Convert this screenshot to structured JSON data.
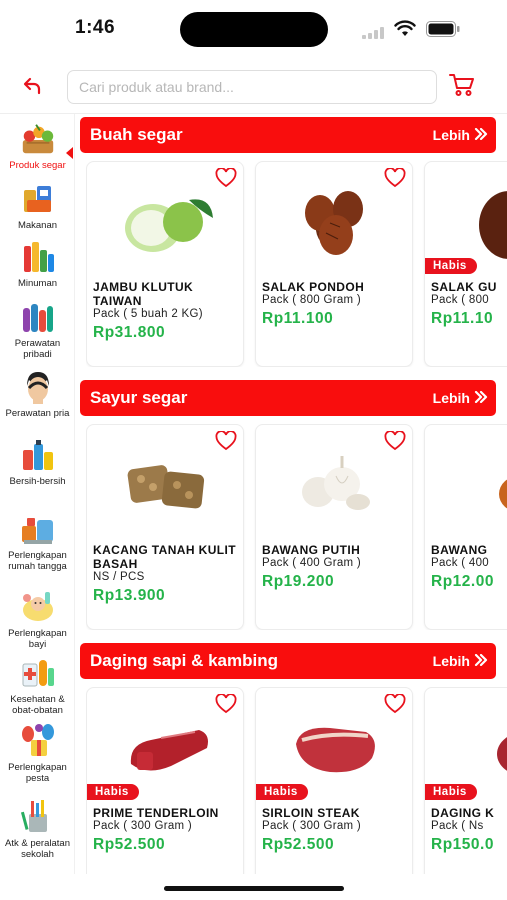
{
  "status": {
    "time": "1:46"
  },
  "search": {
    "placeholder": "Cari produk atau brand..."
  },
  "colors": {
    "accent": "#f90d0d",
    "price": "#25b34a",
    "sold_out": "#e8121d"
  },
  "icons": {
    "back": "back-arrow-icon",
    "cart": "cart-icon",
    "favorite": "heart-outline-icon",
    "more": "double-chevron-right-icon"
  },
  "sidebar": {
    "items": [
      {
        "label": "Produk segar",
        "icon": "fresh-produce-icon",
        "active": true
      },
      {
        "label": "Makanan",
        "icon": "food-icon"
      },
      {
        "label": "Minuman",
        "icon": "drinks-icon"
      },
      {
        "label": "Perawatan pribadi",
        "icon": "personal-care-icon"
      },
      {
        "label": "Perawatan pria",
        "icon": "mens-care-icon"
      },
      {
        "label": "Bersih-bersih",
        "icon": "cleaning-icon"
      },
      {
        "label": "Perlengkapan rumah tangga",
        "icon": "household-icon"
      },
      {
        "label": "Perlengkapan bayi",
        "icon": "baby-icon"
      },
      {
        "label": "Kesehatan & obat-obatan",
        "icon": "health-icon"
      },
      {
        "label": "Perlengkapan pesta",
        "icon": "party-icon"
      },
      {
        "label": "Atk & peralatan sekolah",
        "icon": "stationery-icon"
      }
    ]
  },
  "sections": [
    {
      "title": "Buah segar",
      "more_label": "Lebih",
      "products": [
        {
          "name": "JAMBU KLUTUK TAIWAN",
          "unit": "Pack ( 5 buah 2 KG)",
          "price": "Rp31.800",
          "sold_out": false
        },
        {
          "name": "SALAK PONDOH",
          "unit": "Pack ( 800 Gram )",
          "price": "Rp11.100",
          "sold_out": false
        },
        {
          "name": "SALAK GU",
          "unit": "Pack ( 800",
          "price": "Rp11.10",
          "sold_out": true,
          "badge": "Habis"
        }
      ]
    },
    {
      "title": "Sayur segar",
      "more_label": "Lebih",
      "products": [
        {
          "name": "KACANG TANAH KULIT BASAH",
          "unit": "NS / PCS",
          "price": "Rp13.900",
          "sold_out": false
        },
        {
          "name": "BAWANG PUTIH",
          "unit": "Pack ( 400 Gram )",
          "price": "Rp19.200",
          "sold_out": false
        },
        {
          "name": "BAWANG",
          "unit": "Pack ( 400",
          "price": "Rp12.00",
          "sold_out": false
        }
      ]
    },
    {
      "title": "Daging sapi & kambing",
      "more_label": "Lebih",
      "products": [
        {
          "name": "PRIME TENDERLOIN",
          "unit": "Pack ( 300 Gram )",
          "price": "Rp52.500",
          "sold_out": true,
          "badge": "Habis"
        },
        {
          "name": "SIRLOIN STEAK",
          "unit": "Pack ( 300 Gram )",
          "price": "Rp52.500",
          "sold_out": true,
          "badge": "Habis"
        },
        {
          "name": "DAGING K",
          "unit": "Pack ( Ns",
          "price": "Rp150.0",
          "sold_out": true,
          "badge": "Habis"
        }
      ]
    }
  ]
}
